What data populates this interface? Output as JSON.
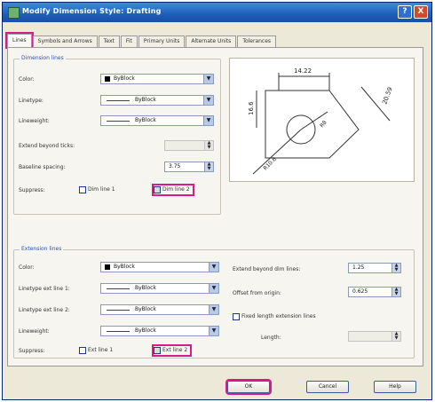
{
  "window": {
    "title": "Modify Dimension Style: Drafting"
  },
  "title_buttons": {
    "help": "?",
    "close": "X"
  },
  "tabs": [
    "Lines",
    "Symbols and Arrows",
    "Text",
    "Fit",
    "Primary Units",
    "Alternate Units",
    "Tolerances"
  ],
  "dimension_lines": {
    "group_label": "Dimension lines",
    "color_label": "Color:",
    "color_value": "ByBlock",
    "linetype_label": "Linetype:",
    "linetype_value": "ByBlock",
    "lineweight_label": "Lineweight:",
    "lineweight_value": "ByBlock",
    "extend_label": "Extend beyond ticks:",
    "baseline_label": "Baseline spacing:",
    "baseline_value": "3.75",
    "suppress_label": "Suppress:",
    "dim_line_1": "Dim line 1",
    "dim_line_2": "Dim line 2"
  },
  "preview": {
    "dim_top": "14.22",
    "dim_left": "16.6",
    "dim_right": "20.59",
    "dim_radius": "R8",
    "dim_diag": "R10.6"
  },
  "extension_lines": {
    "group_label": "Extension lines",
    "color_label": "Color:",
    "color_value": "ByBlock",
    "linetype1_label": "Linetype ext line 1:",
    "linetype1_value": "ByBlock",
    "linetype2_label": "Linetype ext line 2:",
    "linetype2_value": "ByBlock",
    "lineweight_label": "Lineweight:",
    "lineweight_value": "ByBlock",
    "suppress_label": "Suppress:",
    "ext_line_1": "Ext line 1",
    "ext_line_2": "Ext line 2",
    "extend_dim_label": "Extend beyond dim lines:",
    "extend_dim_value": "1.25",
    "offset_label": "Offset from origin:",
    "offset_value": "0.625",
    "fixed_length_label": "Fixed length extension lines",
    "length_label": "Length:"
  },
  "buttons": {
    "ok": "OK",
    "cancel": "Cancel",
    "help": "Help"
  },
  "colors": {
    "highlight": "#d81b8c",
    "title_bar": "#1f5fb8",
    "group_label": "#2b4fb5"
  }
}
